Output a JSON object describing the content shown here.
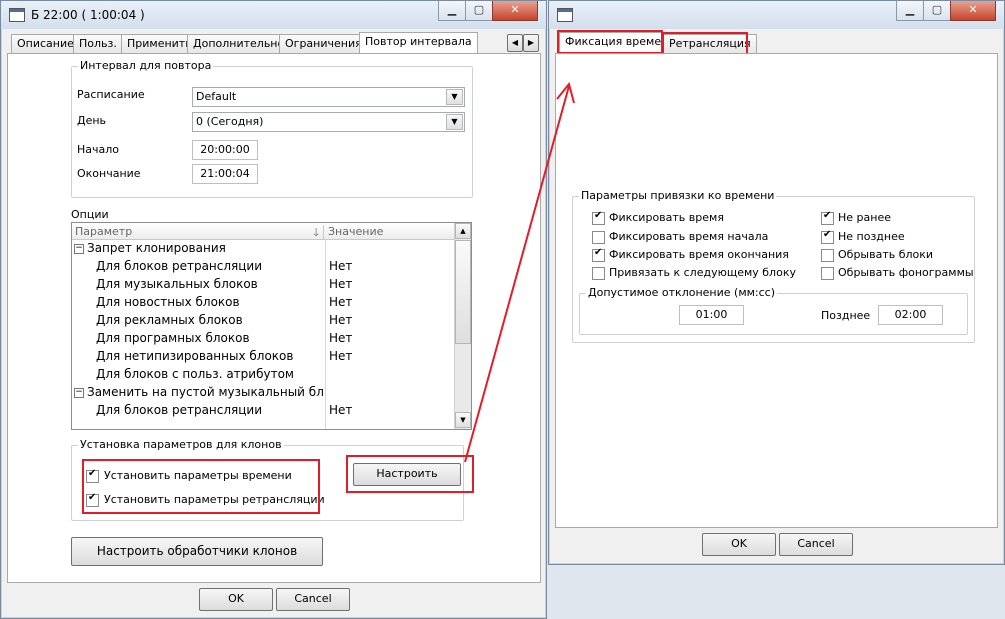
{
  "left_window": {
    "title": "Б 22:00 ( 1:00:04 )",
    "tabs": [
      "Описание",
      "Польз.",
      "Применить",
      "Дополнительно",
      "Ограничения",
      "Повтор интервала"
    ],
    "active_tab": "Повтор интервала",
    "interval_group": {
      "title": "Интервал для повтора",
      "schedule_label": "Расписание",
      "schedule_value": "Default",
      "day_label": "День",
      "day_value": "0 (Сегодня)",
      "start_label": "Начало",
      "start_value": "20:00:00",
      "end_label": "Окончание",
      "end_value": "21:00:04"
    },
    "options": {
      "title": "Опции",
      "col_param": "Параметр",
      "col_value": "Значение",
      "rows": [
        {
          "label": "Запрет клонирования",
          "value": "",
          "group": true
        },
        {
          "label": "Для блоков ретрансляции",
          "value": "Нет",
          "group": false
        },
        {
          "label": "Для музыкальных блоков",
          "value": "Нет",
          "group": false
        },
        {
          "label": "Для новостных блоков",
          "value": "Нет",
          "group": false
        },
        {
          "label": "Для рекламных блоков",
          "value": "Нет",
          "group": false
        },
        {
          "label": "Для програмных блоков",
          "value": "Нет",
          "group": false
        },
        {
          "label": "Для нетипизированных блоков",
          "value": "Нет",
          "group": false
        },
        {
          "label": "Для блоков с польз. атрибутом",
          "value": "",
          "group": false
        },
        {
          "label": "Заменить на пустой музыкальный блок",
          "value": "",
          "group": true
        },
        {
          "label": "Для блоков ретрансляции",
          "value": "Нет",
          "group": false
        }
      ]
    },
    "clones_group": {
      "title": "Установка параметров для клонов",
      "set_time_label": "Установить параметры времени",
      "set_time_checked": true,
      "set_relay_label": "Установить параметры ретрансляции",
      "set_relay_checked": true,
      "configure_button": "Настроить"
    },
    "handlers_button": "Настроить обработчики клонов",
    "ok_button": "OK",
    "cancel_button": "Cancel"
  },
  "right_window": {
    "tabs": [
      "Фиксация времени",
      "Ретрансляция"
    ],
    "active_tab": "Фиксация времени",
    "binding_group": {
      "title": "Параметры привязки ко времени",
      "fix_time": {
        "label": "Фиксировать время",
        "checked": true
      },
      "fix_start": {
        "label": "Фиксировать время начала",
        "checked": false
      },
      "fix_end": {
        "label": "Фиксировать время окончания",
        "checked": true
      },
      "bind_next": {
        "label": "Привязать к следующему блоку",
        "checked": false
      },
      "not_earlier": {
        "label": "Не ранее",
        "checked": true
      },
      "not_later": {
        "label": "Не позднее",
        "checked": true
      },
      "cut_blocks": {
        "label": "Обрывать блоки",
        "checked": false
      },
      "cut_phonograms": {
        "label": "Обрывать фонограммы",
        "checked": false
      }
    },
    "deviation_group": {
      "title": "Допустимое отклонение (мм:сс)",
      "earlier_value": "01:00",
      "later_label": "Позднее",
      "later_value": "02:00"
    },
    "ok_button": "OK",
    "cancel_button": "Cancel"
  },
  "colors": {
    "highlight_red": "#e21d2a",
    "window_bg": "#f0f0f0"
  }
}
